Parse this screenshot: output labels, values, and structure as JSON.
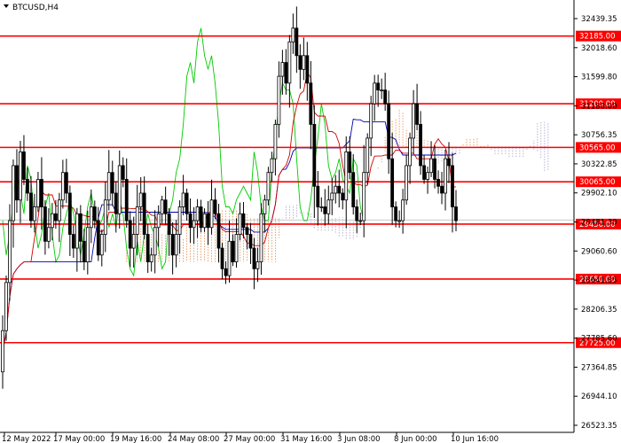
{
  "chart_data": {
    "type": "candlestick",
    "symbol": "BTCUSD,H4",
    "ylim": [
      26523.33,
      32438.5
    ],
    "y_ticks": [
      "32439.35",
      "32018.60",
      "31599.80",
      "31180.00",
      "30756.35",
      "30322.85",
      "29902.10",
      "29481.30",
      "29060.60",
      "28641.85",
      "28206.35",
      "27785.60",
      "27364.85",
      "26944.10",
      "26523.35"
    ],
    "x_ticks": [
      "12 May 2022",
      "17 May 00:00",
      "19 May 16:00",
      "24 May 08:00",
      "27 May 00:00",
      "31 May 16:00",
      "3 Jun 08:00",
      "8 Jun 00:00",
      "10 Jun 16:00"
    ],
    "levels": [
      {
        "value": 32185.0,
        "label": "32185.00"
      },
      {
        "value": 31200.0,
        "label": "31200.00"
      },
      {
        "value": 30565.0,
        "label": "30565.00"
      },
      {
        "value": 30065.0,
        "label": "30065.00"
      },
      {
        "value": 29450.0,
        "label": "29450.00"
      },
      {
        "value": 28650.0,
        "label": "28650.00"
      },
      {
        "value": 27725.0,
        "label": "27725.00"
      }
    ],
    "current_price": 29510,
    "colors": {
      "candle": "#000000",
      "level_line": "#ff0000",
      "level_label_bg": "#ff0000",
      "tenkan": "#d40000",
      "kijun": "#0000b4",
      "chikou": "#00cc00",
      "cloud_bear": "#a8a0c8",
      "cloud_bull": "#e8894a"
    },
    "closes": [
      27900,
      28600,
      29500,
      30300,
      29800,
      30500,
      30100,
      29900,
      29500,
      29700,
      30100,
      29700,
      29200,
      29400,
      29600,
      29500,
      29800,
      30200,
      29900,
      29300,
      29100,
      29600,
      29200,
      28900,
      29400,
      29700,
      29500,
      29000,
      29300,
      29800,
      30200,
      29900,
      29600,
      30300,
      30100,
      29500,
      29100,
      29300,
      29700,
      29900,
      29300,
      28900,
      29000,
      29400,
      29600,
      29800,
      29600,
      29300,
      29000,
      29300,
      29700,
      29900,
      29600,
      29400,
      29500,
      29700,
      29400,
      29600,
      29400,
      29800,
      29600,
      29100,
      28800,
      28700,
      29200,
      28900,
      29300,
      29600,
      29400,
      29300,
      29100,
      28800,
      28900,
      29600,
      29800,
      30200,
      30400,
      30900,
      31600,
      31800,
      31500,
      32100,
      32300,
      31900,
      31700,
      31900,
      31500,
      30900,
      30000,
      29700,
      29700,
      29600,
      29800,
      29900,
      30000,
      29900,
      29800,
      30500,
      30200,
      29700,
      29500,
      29500,
      30200,
      30700,
      31200,
      31500,
      31400,
      31400,
      31200,
      30400,
      29700,
      29500,
      29500,
      29800,
      30300,
      30700,
      31200,
      30900,
      30300,
      30100,
      30200,
      30400,
      30100,
      30000,
      29900,
      30400,
      30300,
      29700,
      29500
    ]
  }
}
